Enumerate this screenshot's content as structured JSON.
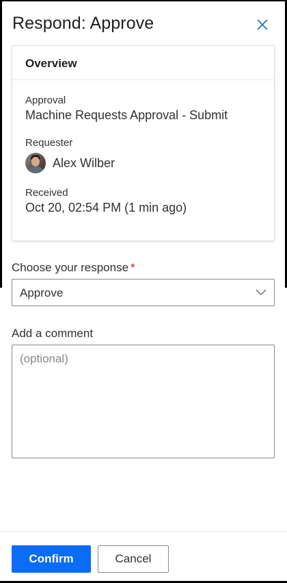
{
  "panel": {
    "title": "Respond: Approve",
    "close_icon": "close-icon"
  },
  "overview": {
    "header": "Overview",
    "approval_label": "Approval",
    "approval_value": "Machine Requests Approval - Submit",
    "requester_label": "Requester",
    "requester_name": "Alex Wilber",
    "received_label": "Received",
    "received_value": "Oct 20, 02:54 PM (1 min ago)"
  },
  "response": {
    "label": "Choose your response",
    "required_marker": "*",
    "selected": "Approve",
    "chevron_icon": "chevron-down-icon"
  },
  "comment": {
    "label": "Add a comment",
    "placeholder": "(optional)",
    "value": ""
  },
  "footer": {
    "confirm_label": "Confirm",
    "cancel_label": "Cancel"
  },
  "colors": {
    "primary": "#0b6cf6",
    "required": "#a4262c",
    "border": "#8a8886"
  }
}
